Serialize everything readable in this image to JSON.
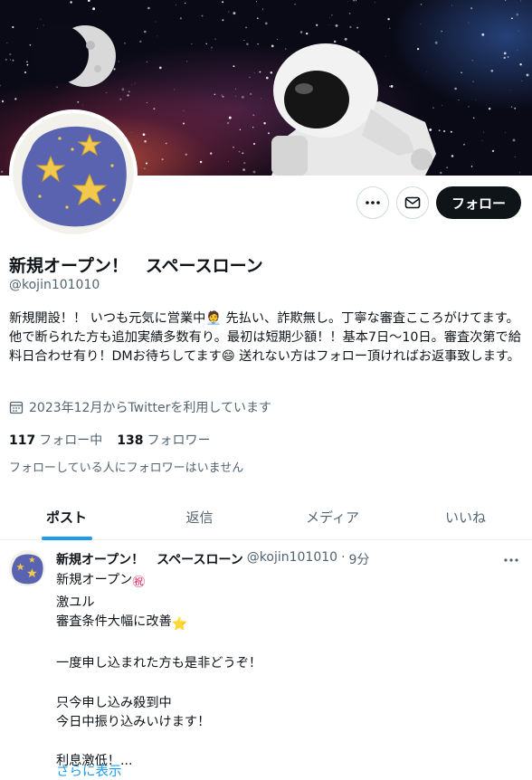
{
  "profile": {
    "display_name": "新規オープン！　スペースローン",
    "handle": "@kojin101010",
    "bio": "新規開設！！ いつも元気に営業中🧑‍💼 先払い、詐欺無し。丁寧な審査こころがけてます。他で断られた方も追加実績多数有り。最初は短期少額！！基本7日〜10日。審査次第で給料日合わせ有り！DMお待ちしてます😄 送れない方はフォロー頂ければお返事致します。",
    "joined": "2023年12月からTwitterを利用しています",
    "following_count": "117",
    "following_label": "フォロー中",
    "followers_count": "138",
    "followers_label": "フォロワー",
    "mutuals_note": "フォローしている人にフォロワーはいません"
  },
  "actions": {
    "more_icon": "more-horizontal-icon",
    "message_icon": "envelope-icon",
    "follow_label": "フォロー"
  },
  "tabs": [
    {
      "label": "ポスト"
    },
    {
      "label": "返信"
    },
    {
      "label": "メディア"
    },
    {
      "label": "いいね"
    }
  ],
  "tweet": {
    "author": "新規オープン！　スペースローン",
    "handle": "@kojin101010",
    "separator": "·",
    "time": "9分",
    "line1": "新規オープン",
    "line1_emoji": "㊗",
    "line2": "激ユル",
    "line3": "審査条件大幅に改善",
    "line3_emoji": "⭐",
    "rest": "\n一度申し込まれた方も是非どうぞ！\n\n只今申し込み殺到中\n今日中振り込みいけます！\n\n利息激低！...",
    "show_more": "さらに表示"
  },
  "colors": {
    "accent": "#1d9bf0",
    "text": "#0f1419",
    "muted": "#536471",
    "avatar_blob": "#5a63b0",
    "star": "#f2c94c"
  }
}
